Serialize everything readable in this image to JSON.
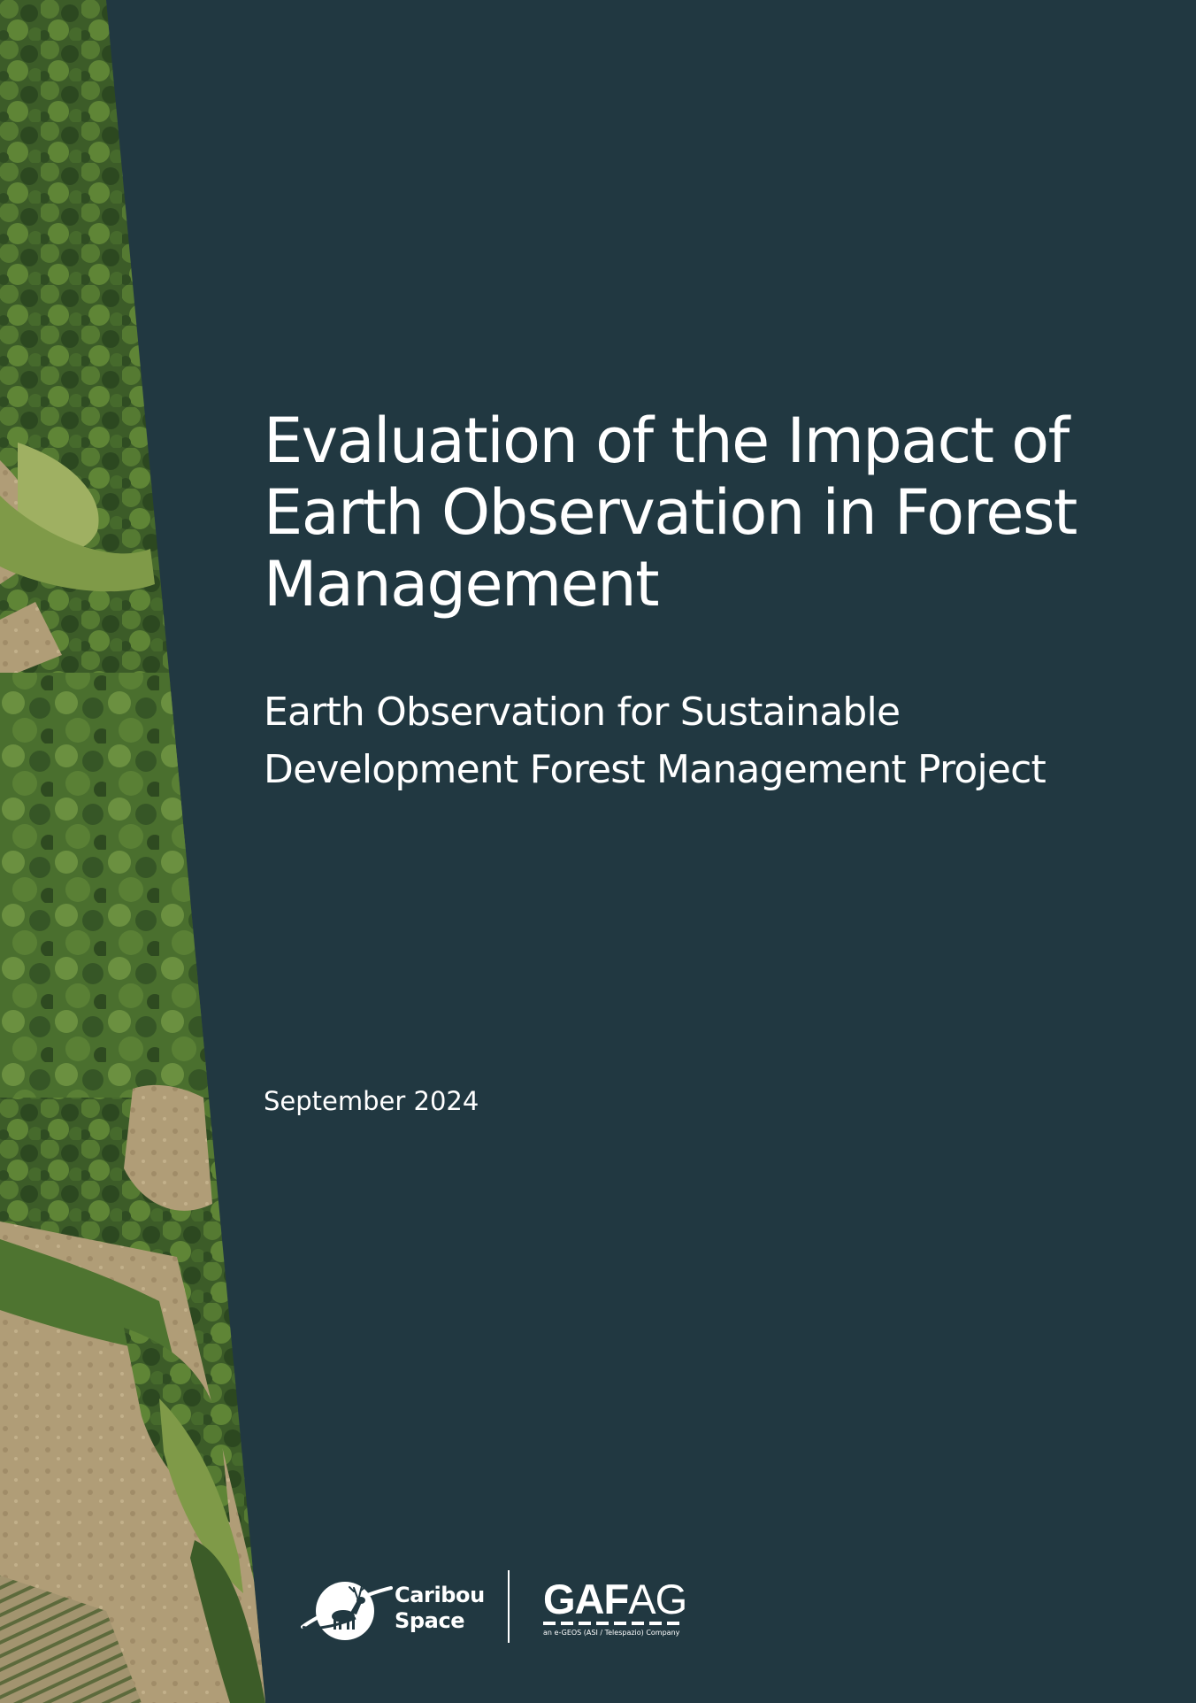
{
  "cover": {
    "title_lines": [
      "Evaluation of the Impact of",
      "Earth Observation in Forest",
      "Management"
    ],
    "subtitle_lines": [
      "Earth Observation for Sustainable",
      "Development Forest Management Project"
    ],
    "date": "September 2024"
  },
  "logos": {
    "caribou": {
      "line1": "Caribou",
      "line2": "Space",
      "icon": "caribou-planet-icon"
    },
    "gafag": {
      "word_bold": "GAF",
      "word_regular": "AG",
      "tagline": "an e-GEOS (ASI / Telespazio) Company"
    }
  },
  "colors": {
    "background": "#213841",
    "text": "#ffffff",
    "forest_dark": "#2f4a22",
    "forest_mid": "#4f7530",
    "grass_light": "#8fa85a",
    "field_beige": "#b2a07a"
  }
}
